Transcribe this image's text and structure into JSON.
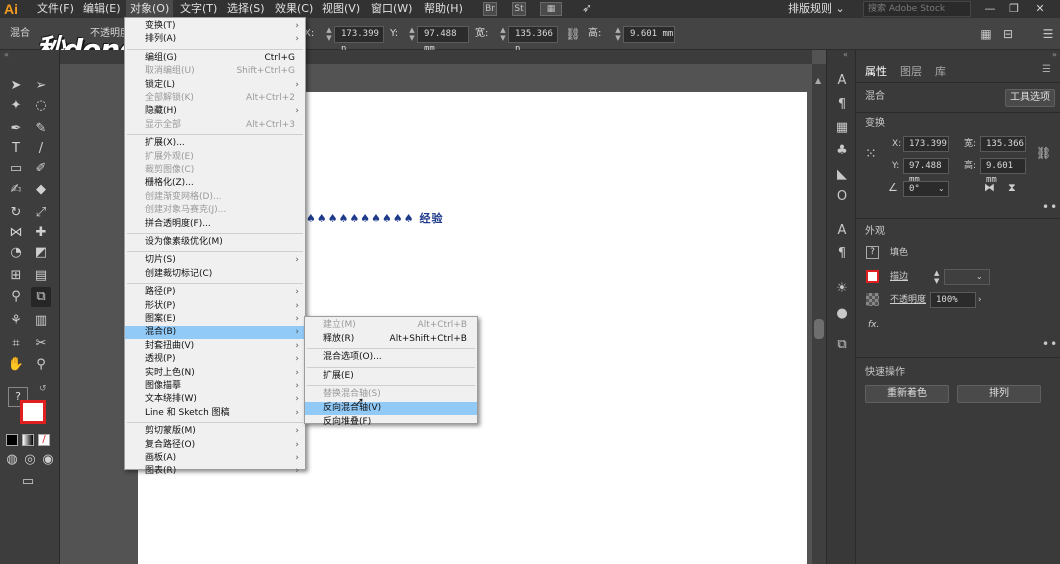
{
  "app": {
    "logo": "Ai",
    "menu": [
      "文件(F)",
      "编辑(E)",
      "对象(O)",
      "文字(T)",
      "选择(S)",
      "效果(C)",
      "视图(V)",
      "窗口(W)",
      "帮助(H)"
    ],
    "bridge_icon": "Br",
    "stock_icon": "St",
    "workspace": "排版规则 ⌄",
    "search_placeholder": "搜索 Adobe Stock",
    "window_controls": [
      "—",
      "❐",
      "✕"
    ]
  },
  "watermark": "秒dong视频",
  "control_bar": {
    "mode_label": "混合",
    "opacity_label": "不透明度",
    "x_label": "X:",
    "x_value": "173.399 n",
    "y_label": "Y:",
    "y_value": "97.488 mm",
    "w_label": "宽:",
    "w_value": "135.366 n",
    "h_label": "高:",
    "h_value": "9.601 mm"
  },
  "canvas": {
    "blend_text": "♠♠♠♠♠♠♠♠♠♠ 经验"
  },
  "object_menu": {
    "items": [
      {
        "label": "变换(T)",
        "shortcut": "",
        "submenu": true,
        "disabled": false
      },
      {
        "label": "排列(A)",
        "shortcut": "",
        "submenu": true,
        "disabled": false
      },
      {
        "sep": true
      },
      {
        "label": "编组(G)",
        "shortcut": "Ctrl+G",
        "submenu": false,
        "disabled": false
      },
      {
        "label": "取消编组(U)",
        "shortcut": "Shift+Ctrl+G",
        "submenu": false,
        "disabled": true
      },
      {
        "label": "锁定(L)",
        "shortcut": "",
        "submenu": true,
        "disabled": false
      },
      {
        "label": "全部解锁(K)",
        "shortcut": "Alt+Ctrl+2",
        "submenu": false,
        "disabled": true
      },
      {
        "label": "隐藏(H)",
        "shortcut": "",
        "submenu": true,
        "disabled": false
      },
      {
        "label": "显示全部",
        "shortcut": "Alt+Ctrl+3",
        "submenu": false,
        "disabled": true
      },
      {
        "sep": true
      },
      {
        "label": "扩展(X)...",
        "shortcut": "",
        "submenu": false,
        "disabled": false
      },
      {
        "label": "扩展外观(E)",
        "shortcut": "",
        "submenu": false,
        "disabled": true
      },
      {
        "label": "裁剪图像(C)",
        "shortcut": "",
        "submenu": false,
        "disabled": true
      },
      {
        "label": "栅格化(Z)...",
        "shortcut": "",
        "submenu": false,
        "disabled": false
      },
      {
        "label": "创建渐变网格(D)...",
        "shortcut": "",
        "submenu": false,
        "disabled": true
      },
      {
        "label": "创建对象马赛克(J)...",
        "shortcut": "",
        "submenu": false,
        "disabled": true
      },
      {
        "label": "拼合透明度(F)...",
        "shortcut": "",
        "submenu": false,
        "disabled": false
      },
      {
        "sep": true
      },
      {
        "label": "设为像素级优化(M)",
        "shortcut": "",
        "submenu": false,
        "disabled": false
      },
      {
        "sep": true
      },
      {
        "label": "切片(S)",
        "shortcut": "",
        "submenu": true,
        "disabled": false
      },
      {
        "label": "创建裁切标记(C)",
        "shortcut": "",
        "submenu": false,
        "disabled": false
      },
      {
        "sep": true
      },
      {
        "label": "路径(P)",
        "shortcut": "",
        "submenu": true,
        "disabled": false
      },
      {
        "label": "形状(P)",
        "shortcut": "",
        "submenu": true,
        "disabled": false
      },
      {
        "label": "图案(E)",
        "shortcut": "",
        "submenu": true,
        "disabled": false
      },
      {
        "label": "混合(B)",
        "shortcut": "",
        "submenu": true,
        "disabled": false,
        "highlight": true
      },
      {
        "label": "封套扭曲(V)",
        "shortcut": "",
        "submenu": true,
        "disabled": false
      },
      {
        "label": "透视(P)",
        "shortcut": "",
        "submenu": true,
        "disabled": false
      },
      {
        "label": "实时上色(N)",
        "shortcut": "",
        "submenu": true,
        "disabled": false
      },
      {
        "label": "图像描摹",
        "shortcut": "",
        "submenu": true,
        "disabled": false
      },
      {
        "label": "文本绕排(W)",
        "shortcut": "",
        "submenu": true,
        "disabled": false
      },
      {
        "label": "Line 和 Sketch 图稿",
        "shortcut": "",
        "submenu": true,
        "disabled": false
      },
      {
        "sep": true
      },
      {
        "label": "剪切蒙版(M)",
        "shortcut": "",
        "submenu": true,
        "disabled": false
      },
      {
        "label": "复合路径(O)",
        "shortcut": "",
        "submenu": true,
        "disabled": false
      },
      {
        "label": "画板(A)",
        "shortcut": "",
        "submenu": true,
        "disabled": false
      },
      {
        "label": "图表(R)",
        "shortcut": "",
        "submenu": true,
        "disabled": false
      }
    ]
  },
  "blend_submenu": {
    "items": [
      {
        "label": "建立(M)",
        "shortcut": "Alt+Ctrl+B",
        "disabled": true
      },
      {
        "label": "释放(R)",
        "shortcut": "Alt+Shift+Ctrl+B",
        "disabled": false
      },
      {
        "sep": true
      },
      {
        "label": "混合选项(O)...",
        "shortcut": "",
        "disabled": false
      },
      {
        "sep": true
      },
      {
        "label": "扩展(E)",
        "shortcut": "",
        "disabled": false
      },
      {
        "sep": true
      },
      {
        "label": "替换混合轴(S)",
        "shortcut": "",
        "disabled": true
      },
      {
        "label": "反向混合轴(V)",
        "shortcut": "",
        "disabled": false,
        "highlight": true
      },
      {
        "label": "反向堆叠(F)",
        "shortcut": "",
        "disabled": false
      }
    ]
  },
  "properties": {
    "tabs": [
      "属性",
      "图层",
      "库"
    ],
    "active_tab": 0,
    "blend_label": "混合",
    "tool_options_button": "工具选项",
    "transform_title": "变换",
    "x_label": "X:",
    "x_value": "173.399",
    "y_label": "Y:",
    "y_value": "97.488 mm",
    "w_label": "宽:",
    "w_value": "135.366",
    "h_label": "高:",
    "h_value": "9.601 mm",
    "angle_value": "0°",
    "appearance_title": "外观",
    "fill_label": "填色",
    "stroke_label": "描边",
    "opacity_label": "不透明度",
    "opacity_value": "100%",
    "fx_label": "fx.",
    "quick_actions_title": "快速操作",
    "recolor_button": "重新着色",
    "arrange_button": "排列"
  },
  "colors": {
    "menubar_bg": "#323232",
    "menu_highlight": "#91c9f7",
    "logo": "#f39a1e",
    "stroke_red": "#e02020"
  }
}
